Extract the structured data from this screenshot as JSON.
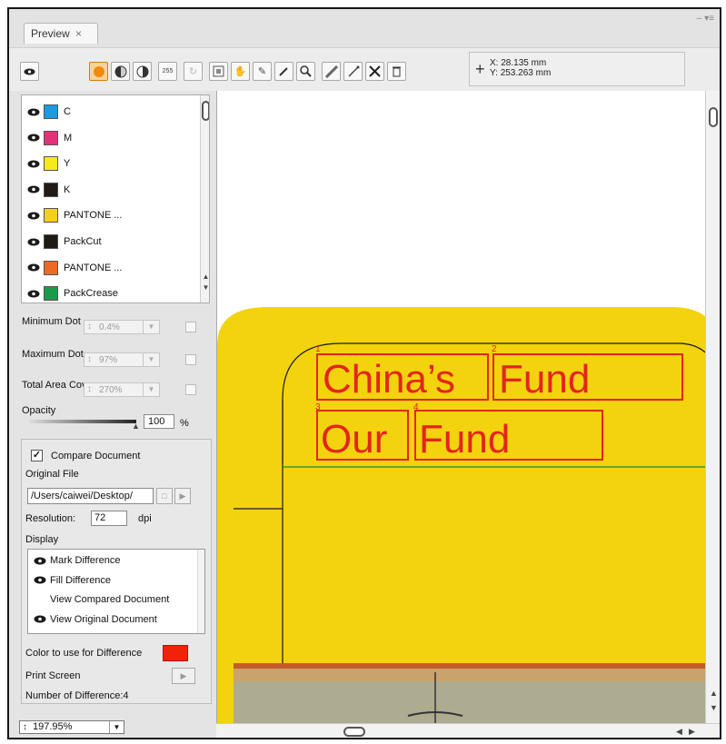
{
  "window": {
    "tab_label": "Preview",
    "tab_close": "×",
    "controls": "– ▾≡"
  },
  "toolbar": {
    "coords": {
      "x_label": "X:",
      "x": "28.135 mm",
      "y_label": "Y:",
      "y": "253.263 mm"
    },
    "tools": [
      "eye-toggle",
      "color-mode",
      "contrast",
      "invert",
      "density-readout",
      "rotate",
      "fit",
      "hand",
      "edit",
      "eyedropper",
      "zoom",
      "measure",
      "ruler",
      "close-marks",
      "trash"
    ],
    "density_text": "255"
  },
  "separations": [
    {
      "label": "C",
      "color": "#1b9ae0"
    },
    {
      "label": "M",
      "color": "#e3317a"
    },
    {
      "label": "Y",
      "color": "#f6ea1a"
    },
    {
      "label": "K",
      "color": "#231a16"
    },
    {
      "label": "PANTONE ...",
      "color": "#f2d01b"
    },
    {
      "label": "PackCut",
      "color": "#1f1a14"
    },
    {
      "label": "PANTONE ...",
      "color": "#ea6a26"
    },
    {
      "label": "PackCrease",
      "color": "#1a9b4c"
    }
  ],
  "params": {
    "min_dot_label": "Minimum Dot",
    "min_dot_value": "0.4%",
    "max_dot_label": "Maximum Dot",
    "max_dot_value": "97%",
    "tac_label": "Total Area Coverage",
    "tac_value": "270%",
    "opacity_label": "Opacity",
    "opacity_value": "100",
    "opacity_unit": "%"
  },
  "compare": {
    "checkbox_label": "Compare Document",
    "checked": true,
    "original_label": "Original File",
    "path": "/Users/caiwei/Desktop/",
    "resolution_label": "Resolution:",
    "resolution_value": "72",
    "resolution_unit": "dpi",
    "display_label": "Display",
    "display_items": [
      {
        "label": "Mark Difference",
        "eye": true
      },
      {
        "label": "Fill Difference",
        "eye": true
      },
      {
        "label": "View Compared Document",
        "eye": false
      },
      {
        "label": "View Original Document",
        "eye": true
      }
    ],
    "color_label": "Color to use for Difference",
    "diff_color": "#f0230a",
    "print_label": "Print Screen",
    "count_text": "Number of Difference:4"
  },
  "zoom": {
    "value": "197.95%"
  },
  "canvas": {
    "line1_a": "China’s",
    "line1_b": "Fund",
    "line2_a": "Our",
    "line2_b": "Fund",
    "markers": [
      "1",
      "2",
      "3",
      "4"
    ],
    "yellow": "#f2d30e",
    "mark_color": "#e3261b"
  }
}
